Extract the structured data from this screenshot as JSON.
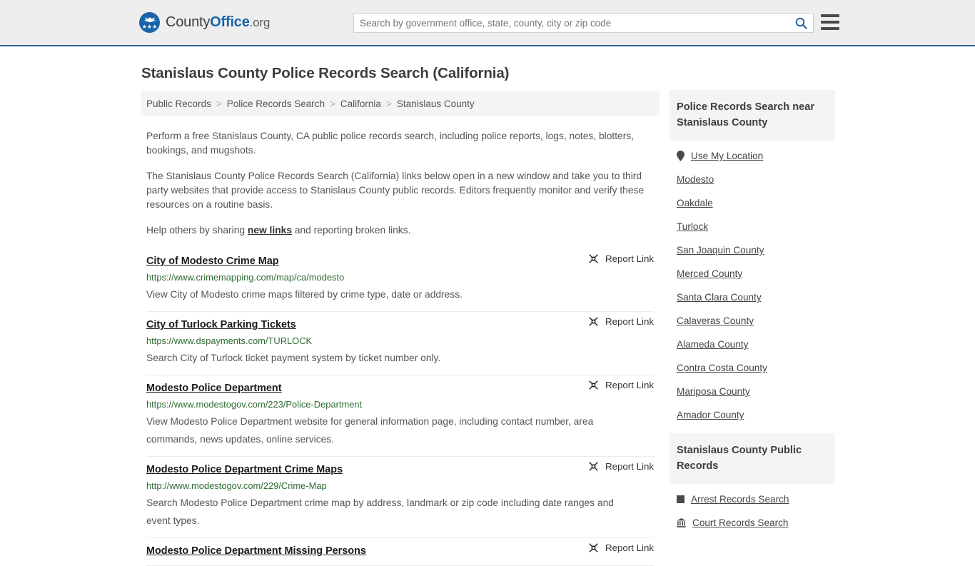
{
  "header": {
    "brand": {
      "county": "County",
      "office": "Office",
      "org": ".org",
      "emblem_icon": "eagle-stars-emblem"
    },
    "search": {
      "placeholder": "Search by government office, state, county, city or zip code",
      "value": "",
      "search_icon": "search-icon"
    },
    "menu_icon": "hamburger-menu-icon",
    "accent_color": "#1a63ab",
    "background_color": "#eeeeee",
    "border_color": "#2a6099"
  },
  "page": {
    "title": "Stanislaus County Police Records Search (California)"
  },
  "breadcrumb": {
    "separator": ">",
    "items": [
      {
        "label": "Public Records"
      },
      {
        "label": "Police Records Search"
      },
      {
        "label": "California"
      },
      {
        "label": "Stanislaus County"
      }
    ]
  },
  "intro": {
    "paragraph1": "Perform a free Stanislaus County, CA public police records search, including police reports, logs, notes, blotters, bookings, and mugshots.",
    "paragraph2": "The Stanislaus County Police Records Search (California) links below open in a new window and take you to third party websites that provide access to Stanislaus County public records. Editors frequently monitor and verify these resources on a routine basis.",
    "paragraph3_before": "Help others by sharing ",
    "paragraph3_link": "new links",
    "paragraph3_after": " and reporting broken links."
  },
  "results": {
    "report_label": "Report Link",
    "report_icon": "broken-link-icon",
    "items": [
      {
        "title": "City of Modesto Crime Map",
        "url": "https://www.crimemapping.com/map/ca/modesto",
        "description": "View City of Modesto crime maps filtered by crime type, date or address."
      },
      {
        "title": "City of Turlock Parking Tickets",
        "url": "https://www.dspayments.com/TURLOCK",
        "description": "Search City of Turlock ticket payment system by ticket number only."
      },
      {
        "title": "Modesto Police Department",
        "url": "https://www.modestogov.com/223/Police-Department",
        "description": "View Modesto Police Department website for general information page, including contact number, area commands, news updates, online services."
      },
      {
        "title": "Modesto Police Department Crime Maps",
        "url": "http://www.modestogov.com/229/Crime-Map",
        "description": "Search Modesto Police Department crime map by address, landmark or zip code including date ranges and event types."
      },
      {
        "title": "Modesto Police Department Missing Persons",
        "url": "",
        "description": ""
      }
    ]
  },
  "sidebar": {
    "nearby": {
      "heading": "Police Records Search near Stanislaus County",
      "items": [
        {
          "label": "Use My Location",
          "icon": "map-pin-icon"
        },
        {
          "label": "Modesto",
          "icon": ""
        },
        {
          "label": "Oakdale",
          "icon": ""
        },
        {
          "label": "Turlock",
          "icon": ""
        },
        {
          "label": "San Joaquin County",
          "icon": ""
        },
        {
          "label": "Merced County",
          "icon": ""
        },
        {
          "label": "Santa Clara County",
          "icon": ""
        },
        {
          "label": "Calaveras County",
          "icon": ""
        },
        {
          "label": "Alameda County",
          "icon": ""
        },
        {
          "label": "Contra Costa County",
          "icon": ""
        },
        {
          "label": "Mariposa County",
          "icon": ""
        },
        {
          "label": "Amador County",
          "icon": ""
        }
      ]
    },
    "public_records": {
      "heading": "Stanislaus County Public Records",
      "items": [
        {
          "label": "Arrest Records Search",
          "icon": "square-icon"
        },
        {
          "label": "Court Records Search",
          "icon": "courthouse-icon"
        }
      ]
    }
  }
}
